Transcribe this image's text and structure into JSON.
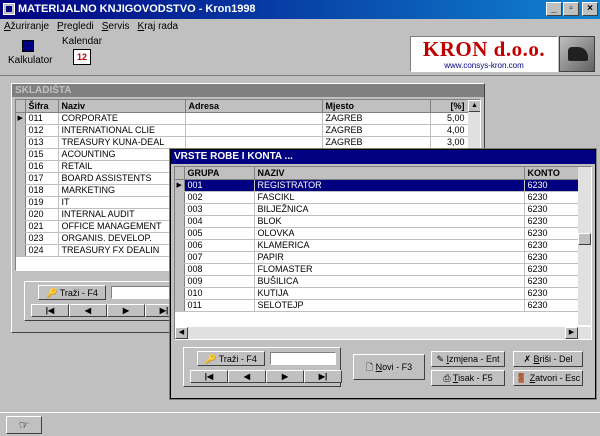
{
  "window": {
    "title": "MATERIJALNO KNJIGOVODSTVO - Kron1998"
  },
  "menu": [
    {
      "key": "A",
      "rest": "žuriranje"
    },
    {
      "key": "P",
      "rest": "regledi"
    },
    {
      "key": "S",
      "rest": "ervis"
    },
    {
      "key": "K",
      "rest": "raj rada"
    }
  ],
  "toolbar": {
    "kalkulator": "Kalkulator",
    "kalendar": "Kalendar",
    "kalendar_glyph": "12"
  },
  "logo": {
    "brand": "KRON d.o.o.",
    "site": "www.consys-kron.com"
  },
  "skladista": {
    "title": "SKLADIŠTA",
    "columns": [
      "Šifra",
      "Naziv",
      "Adresa",
      "Mjesto",
      "[%]"
    ],
    "rows": [
      {
        "sifra": "011",
        "naziv": "CORPORATE",
        "adresa": "",
        "mjesto": "ZAGREB",
        "pct": "5,00"
      },
      {
        "sifra": "012",
        "naziv": "INTERNATIONAL CLIE",
        "adresa": "",
        "mjesto": "ZAGREB",
        "pct": "4,00"
      },
      {
        "sifra": "013",
        "naziv": "TREASURY KUNA-DEAL",
        "adresa": "",
        "mjesto": "ZAGREB",
        "pct": "3,00"
      },
      {
        "sifra": "015",
        "naziv": "ACOUNTING",
        "adresa": "",
        "mjesto": "",
        "pct": ""
      },
      {
        "sifra": "016",
        "naziv": "RETAIL",
        "adresa": "",
        "mjesto": "",
        "pct": ""
      },
      {
        "sifra": "017",
        "naziv": "BOARD ASSISTENTS",
        "adresa": "",
        "mjesto": "",
        "pct": ""
      },
      {
        "sifra": "018",
        "naziv": "MARKETING",
        "adresa": "",
        "mjesto": "",
        "pct": ""
      },
      {
        "sifra": "019",
        "naziv": "IT",
        "adresa": "",
        "mjesto": "",
        "pct": ""
      },
      {
        "sifra": "020",
        "naziv": "INTERNAL AUDIT",
        "adresa": "",
        "mjesto": "",
        "pct": ""
      },
      {
        "sifra": "021",
        "naziv": "OFFICE MANAGEMENT",
        "adresa": "",
        "mjesto": "",
        "pct": ""
      },
      {
        "sifra": "023",
        "naziv": "ORGANIS. DEVELOP.",
        "adresa": "",
        "mjesto": "",
        "pct": ""
      },
      {
        "sifra": "024",
        "naziv": "TREASURY FX DEALIN",
        "adresa": "",
        "mjesto": "",
        "pct": ""
      }
    ],
    "search_label": "Traži - F4",
    "search_value": ""
  },
  "vrste": {
    "title": "VRSTE ROBE I KONTA ...",
    "columns": [
      "GRUPA",
      "NAZIV",
      "KONTO"
    ],
    "rows": [
      {
        "grupa": "001",
        "naziv": "REGISTRATOR",
        "konto": "6230"
      },
      {
        "grupa": "002",
        "naziv": "FASCIKL",
        "konto": "6230"
      },
      {
        "grupa": "003",
        "naziv": "BILJEŽNICA",
        "konto": "6230"
      },
      {
        "grupa": "004",
        "naziv": "BLOK",
        "konto": "6230"
      },
      {
        "grupa": "005",
        "naziv": "OLOVKA",
        "konto": "6230"
      },
      {
        "grupa": "006",
        "naziv": "KLAMERICA",
        "konto": "6230"
      },
      {
        "grupa": "007",
        "naziv": "PAPIR",
        "konto": "6230"
      },
      {
        "grupa": "008",
        "naziv": "FLOMASTER",
        "konto": "6230"
      },
      {
        "grupa": "009",
        "naziv": "BUŠILICA",
        "konto": "6230"
      },
      {
        "grupa": "010",
        "naziv": "KUTIJA",
        "konto": "6230"
      },
      {
        "grupa": "011",
        "naziv": "SELOTEJP",
        "konto": "6230"
      }
    ],
    "search_label": "Traži - F4",
    "search_value": "",
    "buttons": {
      "novi": {
        "key": "N",
        "rest": "ovi - F3"
      },
      "izmjena": {
        "key": "I",
        "rest": "zmjena - Ent"
      },
      "brisi": {
        "key": "B",
        "rest": "riši - Del"
      },
      "tisak": {
        "key": "T",
        "rest": "isak - F5"
      },
      "zatvori": {
        "key": "Z",
        "rest": "atvori - Esc"
      }
    }
  },
  "nav": {
    "first": "|◀",
    "prev": "◀",
    "next": "▶",
    "last": "▶|"
  },
  "colors": {
    "selection": "#000080",
    "face": "#c0c0c0",
    "brand": "#c00000"
  }
}
